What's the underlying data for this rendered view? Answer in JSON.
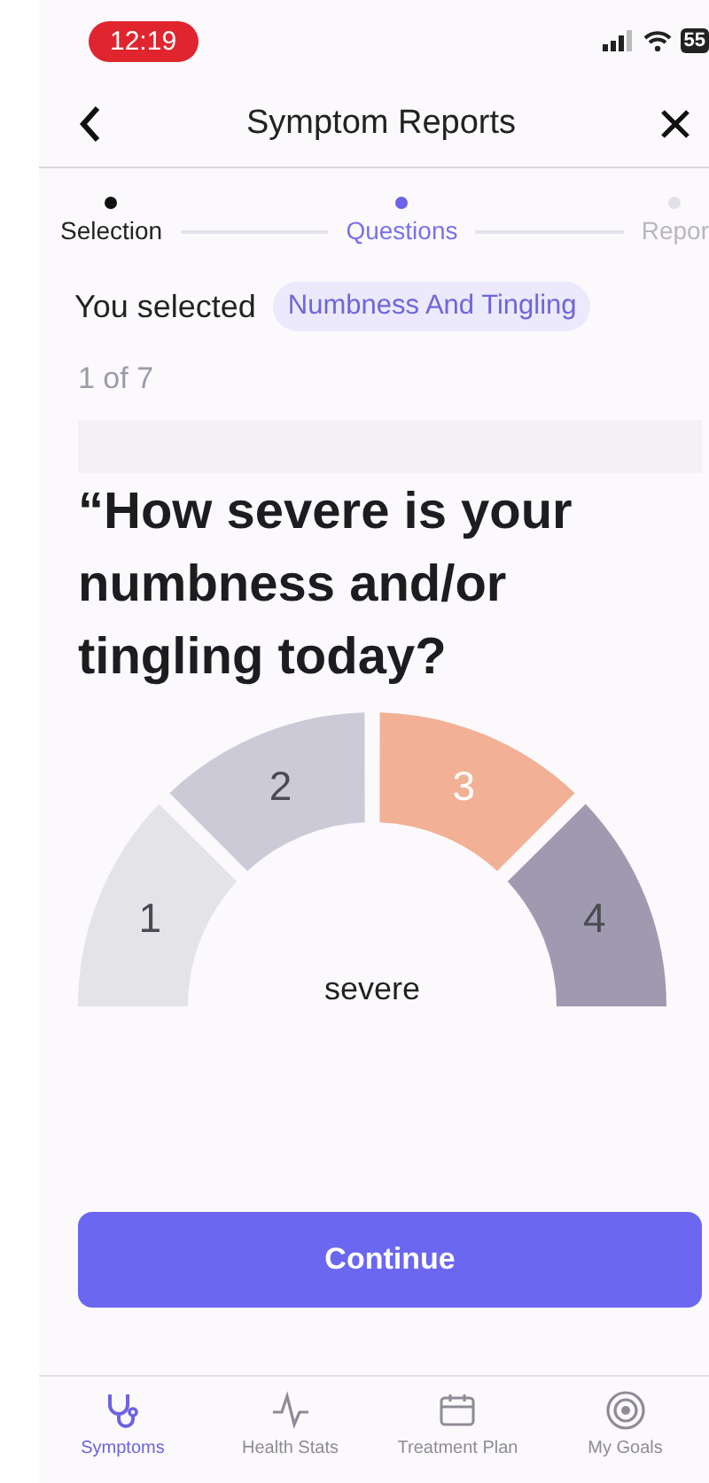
{
  "status_bar": {
    "time": "12:19",
    "battery": "55"
  },
  "nav": {
    "title": "Symptom Reports"
  },
  "steps": [
    {
      "label": "Selection",
      "kind": "done"
    },
    {
      "label": "Questions",
      "kind": "current"
    },
    {
      "label": "Repor",
      "kind": "upcoming"
    }
  ],
  "selection": {
    "label": "You selected",
    "chip": "Numbness And Tingling"
  },
  "progress": "1 of 7",
  "question": "“How severe is your numbness and/or tingling today?",
  "scale": {
    "caption": "severe",
    "segments": [
      {
        "label": "1",
        "color": "#e4e3e8",
        "selected": false
      },
      {
        "label": "2",
        "color": "#cbcad6",
        "selected": false
      },
      {
        "label": "3",
        "color": "#f2b095",
        "selected": true
      },
      {
        "label": "4",
        "color": "#9f9ab0",
        "selected": false
      }
    ]
  },
  "button": "Continue",
  "tabs": [
    {
      "label": "Symptoms",
      "selected": true
    },
    {
      "label": "Health Stats",
      "selected": false
    },
    {
      "label": "Treatment Plan",
      "selected": false
    },
    {
      "label": "My Goals",
      "selected": false
    }
  ]
}
